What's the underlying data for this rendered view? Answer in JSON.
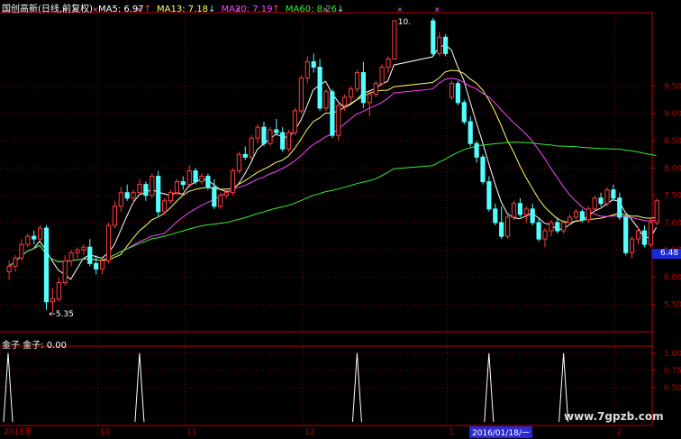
{
  "header": {
    "name": "国创高新(日线,前复权)",
    "ma5": "MA5: 6.97",
    "ma13": "MA13: 7.18",
    "ma20": "MA20: 7.19",
    "ma60": "MA60: 8.26",
    "ma5_arrow": "↑",
    "ma13_arrow": "↓",
    "ma20_arrow": "↑",
    "ma60_arrow": "↓"
  },
  "subchart": {
    "label": "金子  金子: 0.00"
  },
  "watermark": "www.7gpzb.com",
  "current_price": "6.48",
  "cursor_date": "2016/01/18/一",
  "annotations": {
    "low": "5.35",
    "high": "10."
  },
  "colors": {
    "up": "#ff3c3c",
    "down": "#54ffff",
    "ma5": "#ffffff",
    "ma13": "#ffff66",
    "ma20": "#ff44ff",
    "ma60": "#33ee33",
    "axis": "#c00000",
    "grid": "#8a0000"
  },
  "chart_data": {
    "type": "candlestick",
    "ylim": [
      5.0,
      10.85
    ],
    "yticks": [
      "9.50",
      "9.00",
      "8.50",
      "8.00",
      "7.50",
      "7.00",
      "6.50",
      "6.00",
      "5.50"
    ],
    "xlabels": [
      "2015年",
      "10",
      "11",
      "12",
      "1",
      "2"
    ],
    "gap_after_index": 62,
    "ohlc": [
      [
        6.1,
        6.3,
        5.95,
        6.2
      ],
      [
        6.2,
        6.4,
        6.1,
        6.35
      ],
      [
        6.35,
        6.7,
        6.3,
        6.6
      ],
      [
        6.6,
        6.8,
        6.55,
        6.75
      ],
      [
        6.75,
        6.85,
        6.6,
        6.7
      ],
      [
        6.7,
        6.95,
        6.65,
        6.9
      ],
      [
        6.9,
        6.95,
        5.4,
        5.55
      ],
      [
        5.55,
        5.8,
        5.35,
        5.6
      ],
      [
        5.6,
        6.0,
        5.55,
        5.9
      ],
      [
        5.9,
        6.4,
        5.85,
        6.3
      ],
      [
        6.3,
        6.5,
        6.2,
        6.45
      ],
      [
        6.45,
        6.55,
        6.35,
        6.5
      ],
      [
        6.5,
        6.6,
        6.4,
        6.55
      ],
      [
        6.55,
        6.7,
        6.2,
        6.25
      ],
      [
        6.25,
        6.4,
        6.05,
        6.15
      ],
      [
        6.15,
        6.35,
        6.05,
        6.3
      ],
      [
        6.3,
        7.0,
        6.25,
        6.95
      ],
      [
        6.95,
        7.4,
        6.9,
        7.3
      ],
      [
        7.3,
        7.65,
        7.2,
        7.55
      ],
      [
        7.55,
        7.7,
        7.4,
        7.45
      ],
      [
        7.45,
        7.6,
        7.35,
        7.55
      ],
      [
        7.55,
        7.8,
        7.5,
        7.7
      ],
      [
        7.7,
        7.75,
        7.4,
        7.5
      ],
      [
        7.5,
        7.9,
        7.45,
        7.85
      ],
      [
        7.85,
        7.95,
        7.1,
        7.2
      ],
      [
        7.2,
        7.45,
        7.15,
        7.4
      ],
      [
        7.4,
        7.6,
        7.35,
        7.55
      ],
      [
        7.55,
        7.8,
        7.5,
        7.75
      ],
      [
        7.75,
        7.85,
        7.6,
        7.7
      ],
      [
        7.7,
        8.05,
        7.65,
        7.95
      ],
      [
        7.95,
        8.0,
        7.7,
        7.75
      ],
      [
        7.75,
        7.9,
        7.7,
        7.85
      ],
      [
        7.85,
        7.9,
        7.6,
        7.65
      ],
      [
        7.65,
        7.8,
        7.25,
        7.3
      ],
      [
        7.3,
        7.55,
        7.25,
        7.5
      ],
      [
        7.5,
        7.6,
        7.45,
        7.55
      ],
      [
        7.55,
        8.0,
        7.5,
        7.95
      ],
      [
        7.95,
        8.3,
        7.9,
        8.25
      ],
      [
        8.25,
        8.4,
        8.15,
        8.2
      ],
      [
        8.2,
        8.6,
        8.15,
        8.55
      ],
      [
        8.55,
        8.8,
        8.45,
        8.75
      ],
      [
        8.75,
        8.85,
        8.4,
        8.45
      ],
      [
        8.45,
        8.75,
        8.4,
        8.7
      ],
      [
        8.7,
        8.9,
        8.6,
        8.65
      ],
      [
        8.65,
        8.75,
        8.3,
        8.35
      ],
      [
        8.35,
        8.7,
        8.3,
        8.65
      ],
      [
        8.65,
        9.1,
        8.6,
        9.05
      ],
      [
        9.05,
        9.7,
        9.0,
        9.65
      ],
      [
        9.65,
        10.05,
        9.55,
        9.95
      ],
      [
        9.95,
        10.1,
        9.75,
        9.85
      ],
      [
        9.85,
        10.0,
        9.05,
        9.1
      ],
      [
        9.1,
        9.45,
        9.05,
        9.4
      ],
      [
        9.4,
        9.45,
        8.55,
        8.6
      ],
      [
        8.6,
        9.2,
        8.5,
        9.15
      ],
      [
        9.15,
        9.35,
        9.05,
        9.3
      ],
      [
        9.3,
        9.5,
        9.2,
        9.45
      ],
      [
        9.45,
        9.8,
        9.4,
        9.75
      ],
      [
        9.75,
        9.95,
        9.1,
        9.2
      ],
      [
        9.2,
        9.4,
        8.95,
        9.35
      ],
      [
        9.35,
        9.6,
        9.3,
        9.55
      ],
      [
        9.55,
        9.9,
        9.5,
        9.85
      ],
      [
        9.85,
        10.05,
        9.75,
        10.0
      ],
      [
        10.0,
        10.7,
        10.0,
        10.7
      ],
      [
        10.7,
        10.75,
        10.05,
        10.1
      ],
      [
        10.1,
        10.5,
        10.05,
        10.4
      ],
      [
        10.4,
        10.45,
        10.05,
        10.1
      ],
      [
        9.3,
        9.6,
        9.25,
        9.55
      ],
      [
        9.55,
        9.6,
        9.15,
        9.2
      ],
      [
        9.2,
        9.25,
        8.8,
        8.85
      ],
      [
        8.85,
        8.95,
        8.4,
        8.45
      ],
      [
        8.45,
        8.5,
        8.1,
        8.2
      ],
      [
        8.2,
        8.25,
        7.7,
        7.75
      ],
      [
        7.75,
        7.85,
        7.2,
        7.25
      ],
      [
        7.25,
        7.35,
        6.95,
        7.0
      ],
      [
        7.0,
        7.3,
        6.7,
        6.75
      ],
      [
        6.75,
        7.15,
        6.7,
        7.1
      ],
      [
        7.1,
        7.4,
        7.05,
        7.35
      ],
      [
        7.35,
        7.45,
        7.1,
        7.15
      ],
      [
        7.15,
        7.3,
        7.0,
        7.25
      ],
      [
        7.25,
        7.35,
        6.95,
        7.0
      ],
      [
        7.0,
        7.1,
        6.65,
        6.7
      ],
      [
        6.7,
        6.9,
        6.55,
        6.85
      ],
      [
        6.85,
        7.05,
        6.75,
        7.0
      ],
      [
        7.0,
        7.1,
        6.8,
        6.85
      ],
      [
        6.85,
        7.05,
        6.8,
        7.0
      ],
      [
        7.0,
        7.15,
        6.95,
        7.1
      ],
      [
        7.1,
        7.25,
        7.05,
        7.2
      ],
      [
        7.2,
        7.25,
        7.0,
        7.05
      ],
      [
        7.05,
        7.3,
        7.0,
        7.25
      ],
      [
        7.25,
        7.5,
        7.2,
        7.45
      ],
      [
        7.45,
        7.55,
        7.3,
        7.35
      ],
      [
        7.35,
        7.65,
        7.3,
        7.6
      ],
      [
        7.6,
        7.7,
        7.4,
        7.45
      ],
      [
        7.45,
        7.55,
        7.05,
        7.1
      ],
      [
        7.1,
        7.15,
        6.4,
        6.45
      ],
      [
        6.45,
        6.75,
        6.35,
        6.7
      ],
      [
        6.7,
        6.9,
        6.6,
        6.85
      ],
      [
        6.85,
        6.95,
        6.55,
        6.6
      ],
      [
        6.6,
        7.1,
        6.55,
        7.0
      ],
      [
        7.0,
        7.45,
        6.95,
        7.4
      ]
    ],
    "ma_labels": [
      "MA5",
      "MA13",
      "MA20",
      "MA60"
    ],
    "sub_ylim": [
      0,
      1.05
    ],
    "sub_yticks": [
      "1.00",
      "0.75",
      "0.50"
    ],
    "signal_indices": [
      0,
      21,
      56,
      72,
      84
    ]
  }
}
